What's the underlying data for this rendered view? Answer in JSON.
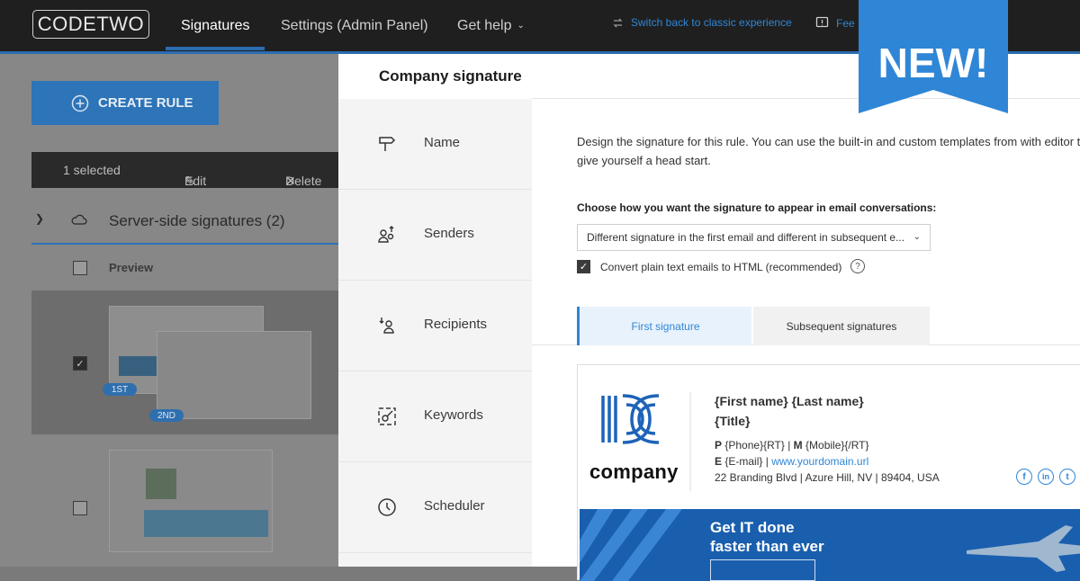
{
  "app": {
    "logo": "CODETWO",
    "nav": [
      {
        "label": "Signatures"
      },
      {
        "label": "Settings (Admin Panel)"
      },
      {
        "label": "Get help"
      }
    ],
    "switch_label": "Switch back to classic experience",
    "feedback_label": "Fee"
  },
  "page": {
    "create_rule": "CREATE RULE",
    "toolbar": {
      "selected": "1 selected",
      "edit": "Edit",
      "delete": "Delete"
    },
    "section_title": "Server-side signatures (2)",
    "preview_header": "Preview",
    "pills": {
      "first": "1ST",
      "second": "2ND"
    }
  },
  "panel": {
    "title": "Company signature",
    "side_items": [
      {
        "label": "Name",
        "icon": "signpost-icon"
      },
      {
        "label": "Senders",
        "icon": "senders-icon"
      },
      {
        "label": "Recipients",
        "icon": "recipients-icon"
      },
      {
        "label": "Keywords",
        "icon": "keywords-icon"
      },
      {
        "label": "Scheduler",
        "icon": "clock-icon"
      }
    ],
    "description": "Design the signature for this rule. You can use the built-in and custom templates from with editor to give yourself a head start.",
    "choose_label": "Choose how you want the signature to appear in email conversations:",
    "select_value": "Different signature in the first email and different in subsequent e...",
    "convert_label": "Convert plain text emails to HTML (recommended)",
    "convert_checked": true,
    "tabs": [
      {
        "label": "First signature",
        "active": true
      },
      {
        "label": "Subsequent signatures",
        "active": false
      }
    ],
    "signature": {
      "company": "company",
      "name": "{First name} {Last name}",
      "title": "{Title}",
      "phone_line": {
        "p": "P",
        "phone": "{Phone}{RT}",
        "m": "M",
        "mobile": "{Mobile}{/RT}"
      },
      "email_line": {
        "e": "E",
        "email": "{E-mail}",
        "url": "www.yourdomain.url"
      },
      "address": "22 Branding Blvd | Azure Hill, NV | 89404, USA",
      "banner": [
        "Get IT done",
        "faster than ever"
      ],
      "social": [
        "f",
        "in",
        "t"
      ]
    }
  },
  "ribbon": {
    "label": "NEW!"
  },
  "colors": {
    "accent": "#2f86d6",
    "ribbon": "#2f86d6",
    "topbar": "#1f1f1f"
  }
}
